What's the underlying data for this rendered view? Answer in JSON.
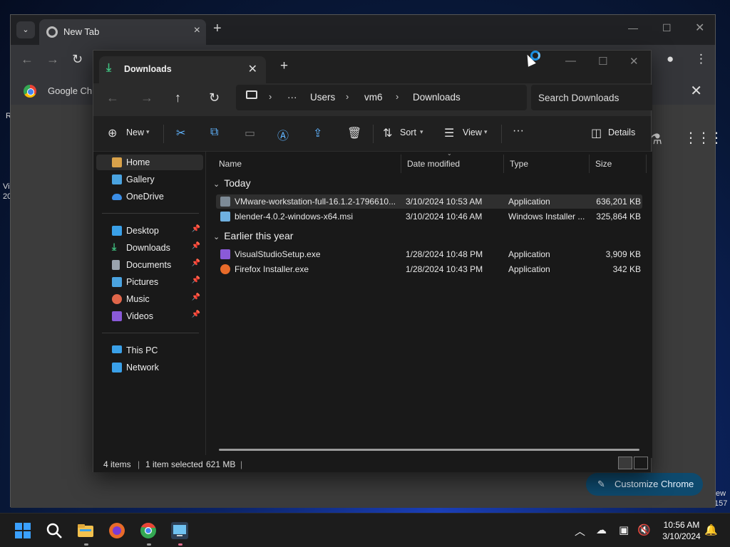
{
  "desktop": {
    "left_fragment_1": "R",
    "left_fragment_2": "Vi",
    "left_fragment_3": "20",
    "right_fragment_1": "ew",
    "right_fragment_2": "157"
  },
  "chrome": {
    "tab_title": "New Tab",
    "bookmark_label": "Google Ch",
    "customize_label": "Customize Chrome"
  },
  "explorer": {
    "tab_title": "Downloads",
    "breadcrumb": [
      "Users",
      "vm6",
      "Downloads"
    ],
    "breadcrumb_more": "···",
    "search_placeholder": "Search Downloads",
    "commands": {
      "new": "New",
      "sort": "Sort",
      "view": "View",
      "more": "···",
      "details": "Details"
    },
    "sidebar": {
      "top": [
        {
          "label": "Home",
          "icon": "home-icon",
          "color": "#d9a24a"
        },
        {
          "label": "Gallery",
          "icon": "gallery-icon",
          "color": "#4aa3e0"
        },
        {
          "label": "OneDrive",
          "icon": "cloud-icon",
          "color": "#3b8ee6"
        }
      ],
      "pinned": [
        {
          "label": "Desktop",
          "icon": "desktop-icon",
          "color": "#3aa0e8"
        },
        {
          "label": "Downloads",
          "icon": "download-icon",
          "color": "#3fbf7f"
        },
        {
          "label": "Documents",
          "icon": "document-icon",
          "color": "#9aa3ad"
        },
        {
          "label": "Pictures",
          "icon": "pictures-icon",
          "color": "#4aa3e0"
        },
        {
          "label": "Music",
          "icon": "music-icon",
          "color": "#e0664a"
        },
        {
          "label": "Videos",
          "icon": "videos-icon",
          "color": "#8a5ad8"
        }
      ],
      "devices": [
        {
          "label": "This PC",
          "icon": "pc-icon",
          "color": "#3aa0e8"
        },
        {
          "label": "Network",
          "icon": "network-icon",
          "color": "#3aa0e8"
        }
      ]
    },
    "columns": [
      "Name",
      "Date modified",
      "Type",
      "Size"
    ],
    "groups": [
      {
        "label": "Today",
        "files": [
          {
            "name": "VMware-workstation-full-16.1.2-1796610...",
            "date": "3/10/2024 10:53 AM",
            "type": "Application",
            "size": "636,201 KB",
            "icon": "vmware-icon",
            "color": "#7d8a96"
          },
          {
            "name": "blender-4.0.2-windows-x64.msi",
            "date": "3/10/2024 10:46 AM",
            "type": "Windows Installer ...",
            "size": "325,864 KB",
            "icon": "installer-icon",
            "color": "#6fb0e0"
          }
        ]
      },
      {
        "label": "Earlier this year",
        "files": [
          {
            "name": "VisualStudioSetup.exe",
            "date": "1/28/2024 10:48 PM",
            "type": "Application",
            "size": "3,909 KB",
            "icon": "visual-studio-icon",
            "color": "#8a5ad8"
          },
          {
            "name": "Firefox Installer.exe",
            "date": "1/28/2024 10:43 PM",
            "type": "Application",
            "size": "342 KB",
            "icon": "firefox-icon",
            "color": "#e86b2a"
          }
        ]
      }
    ],
    "status": {
      "items": "4 items",
      "selected": "1 item selected",
      "size": "621 MB"
    }
  },
  "taskbar": {
    "time": "10:56 AM",
    "date": "3/10/2024"
  }
}
